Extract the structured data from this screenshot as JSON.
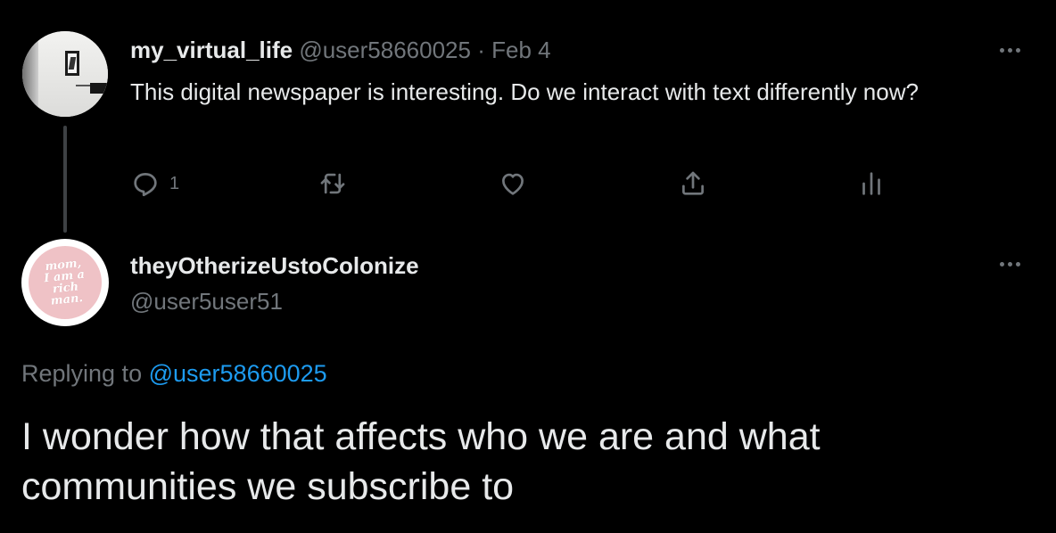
{
  "parent_tweet": {
    "display_name": "my_virtual_life",
    "handle": "@user58660025",
    "separator": "·",
    "date": "Feb 4",
    "text": "This digital newspaper is interesting. Do we interact with text differently now?",
    "actions": {
      "reply": {
        "icon": "reply-icon",
        "count": "1"
      },
      "retweet": {
        "icon": "retweet-icon",
        "count": ""
      },
      "like": {
        "icon": "heart-icon",
        "count": ""
      },
      "share": {
        "icon": "share-icon"
      },
      "analytics": {
        "icon": "analytics-icon"
      }
    }
  },
  "reply_tweet": {
    "display_name": "theyOtherizeUstoColonize",
    "handle": "@user5user51",
    "avatar_text": "mom,\nI am a\nrich\nman.",
    "replying_to_label": "Replying to",
    "replying_to_handle": "@user58660025",
    "text": "I wonder how that affects who we are and what communities we subscribe to"
  },
  "colors": {
    "background": "#000000",
    "primary_text": "#e7e9ea",
    "secondary_text": "#71767b",
    "link": "#1d9bf0",
    "thread_line": "#3e4144",
    "avatar_pink": "#efc2c6"
  }
}
